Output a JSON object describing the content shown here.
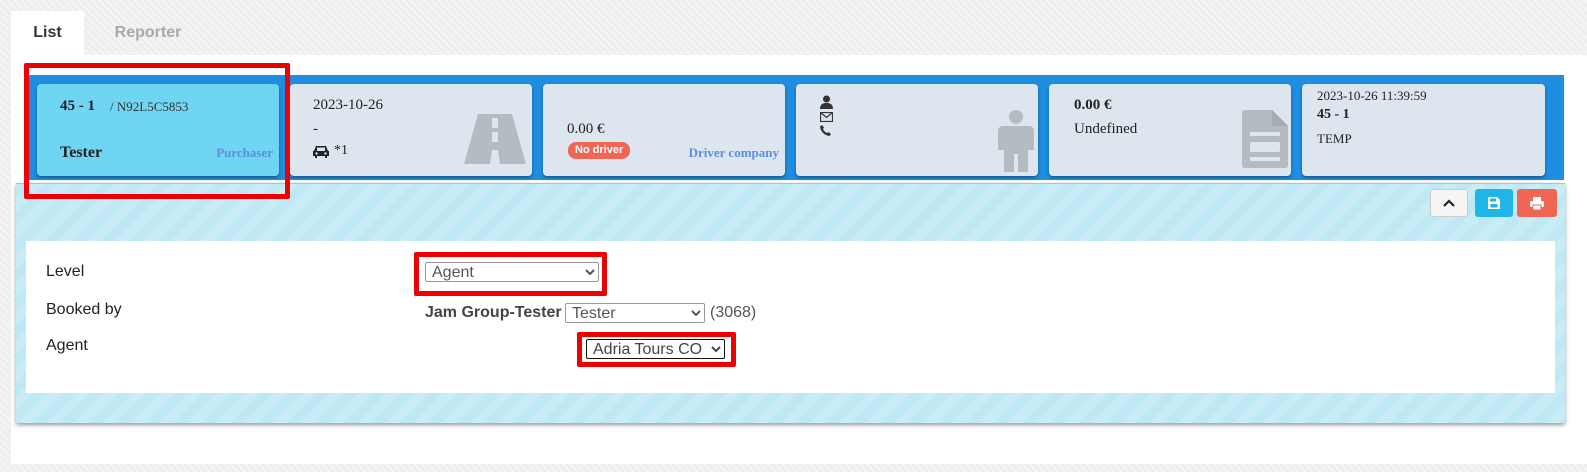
{
  "tabs": [
    {
      "label": "List",
      "active": true
    },
    {
      "label": "Reporter",
      "active": false
    }
  ],
  "cards": {
    "purchaser": {
      "id": "45 - 1",
      "code": "/ N92L5C5853",
      "name": "Tester",
      "role": "Purchaser"
    },
    "route": {
      "date": "2023-10-26",
      "dash": "-",
      "vehicle_count": "*1",
      "icon": "road-icon"
    },
    "driver": {
      "price": "0.00 €",
      "badge": "No driver",
      "company": "Driver company",
      "icon": "person-icon"
    },
    "contact": {
      "icons": [
        "user-icon",
        "envelope-icon",
        "phone-icon"
      ]
    },
    "invoice": {
      "amount": "0.00 €",
      "status": "Undefined",
      "icon": "document-icon"
    },
    "meta": {
      "timestamp": "2023-10-26 11:39:59",
      "id": "45 - 1",
      "status": "TEMP"
    }
  },
  "form": {
    "level_label": "Level",
    "level_value": "Agent",
    "booked_by_label": "Booked by",
    "booked_by_group": "Jam Group-Tester",
    "booked_by_value": "Tester",
    "booked_by_count": "(3068)",
    "agent_label": "Agent",
    "agent_value": "Adria Tours CO"
  },
  "colors": {
    "highlight": "#ee0000",
    "summary_bar": "#1f8de0",
    "active_card": "#6fd5f3",
    "badge": "#ef6655",
    "save_button": "#1fb5e8",
    "print_button": "#ef6655"
  }
}
